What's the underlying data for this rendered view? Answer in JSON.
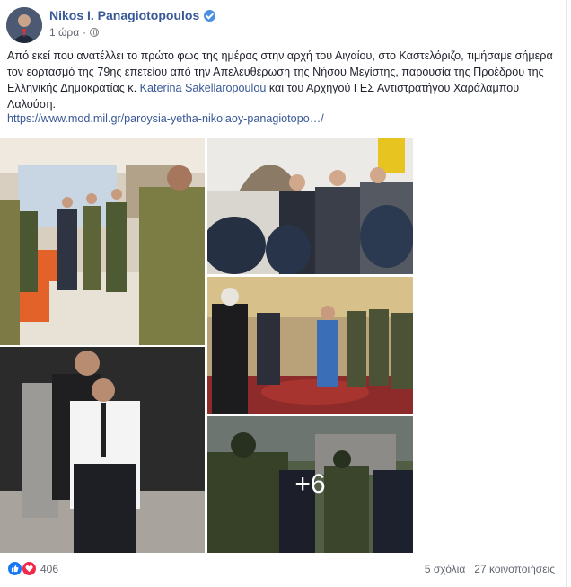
{
  "post": {
    "author": "Nikos I. Panagiotopoulos",
    "time": "1 ώρα",
    "time_sep": "·",
    "text_before_link": "Από εκεί που ανατέλλει το πρώτο φως της ημέρας στην αρχή του Αιγαίου, στο Καστελόριζο, τιμήσαμε σήμερα τον εορτασμό της 79ης επετείου από την Απελευθέρωση της Νήσου Μεγίστης, παρουσία της Προέδρου της Ελληνικής Δημοκρατίας κ.",
    "mention": "Katerina Sakellaropoulou",
    "text_after_link": "και του Αρχηγού ΓΕΣ Αντιστρατήγου Χαράλαμπου Λαλούση.",
    "url": "https://www.mod.mil.gr/paroysia-yetha-nikolaoy-panagiotopo…/",
    "more_photos": "+6"
  },
  "reactions": {
    "count": "406",
    "like_icon": "thumbs-up-icon",
    "love_icon": "heart-icon"
  },
  "stats": {
    "comments": "5 σχόλια",
    "shares": "27 κοινοποιήσεις"
  },
  "colors": {
    "link": "#385898",
    "text": "#1d2129",
    "meta": "#616770",
    "like": "#1877f2",
    "love": "#f0284a"
  }
}
